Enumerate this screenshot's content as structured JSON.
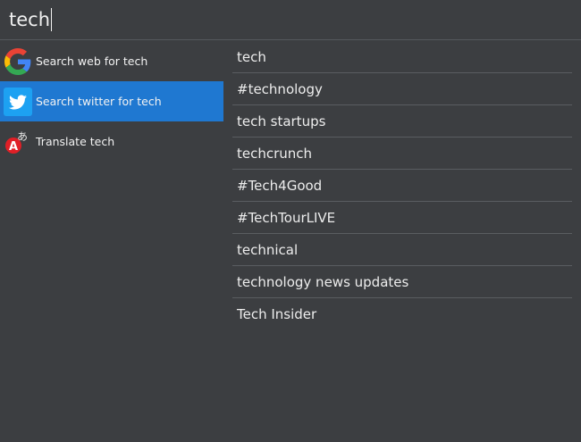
{
  "search": {
    "query": "tech"
  },
  "actions": [
    {
      "label": "Search web for tech",
      "icon": "google-icon"
    },
    {
      "label": "Search twitter for tech",
      "icon": "twitter-icon",
      "selected": true
    },
    {
      "label": "Translate tech",
      "icon": "translate-icon"
    }
  ],
  "suggestions": [
    "tech",
    "#technology",
    "tech startups",
    "techcrunch",
    "#Tech4Good",
    "#TechTourLIVE",
    "technical",
    "technology news updates",
    "Tech Insider"
  ],
  "colors": {
    "background": "#3c3e41",
    "selected": "#1f78d1",
    "twitter": "#1da1f2",
    "translate_red": "#e01f26"
  }
}
